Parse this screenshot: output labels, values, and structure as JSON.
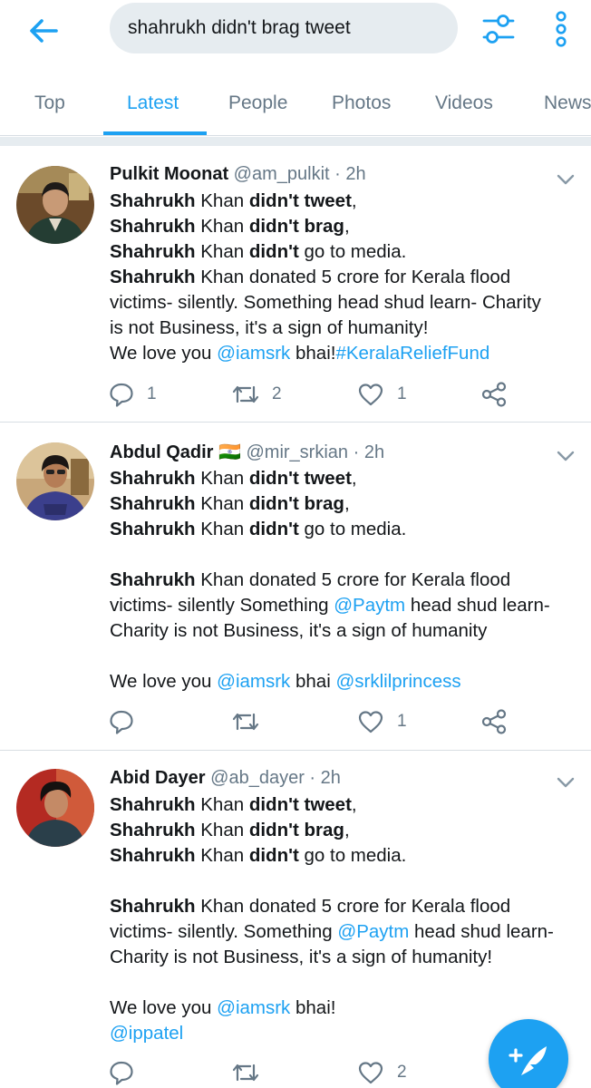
{
  "header": {
    "back_icon": "arrow-left-icon",
    "search_value": "shahrukh didn't brag tweet",
    "filter_icon": "sliders-icon",
    "more_icon": "vertical-dots-icon",
    "accent_color": "#1da1f2"
  },
  "tabs": [
    {
      "label": "Top"
    },
    {
      "label": "Latest",
      "active": true
    },
    {
      "label": "People"
    },
    {
      "label": "Photos"
    },
    {
      "label": "Videos"
    },
    {
      "label": "News"
    }
  ],
  "tweets": [
    {
      "name": "Pulkit Moonat",
      "handle": "@am_pulkit",
      "sep": "·",
      "time": "2h",
      "lines": [
        [
          "Shahrukh",
          "Khan",
          "didn't tweet",
          ","
        ],
        [
          "Shahrukh",
          "Khan",
          "didn't brag",
          ","
        ],
        [
          "Shahrukh",
          "Khan",
          "didn't",
          "go to media."
        ],
        [
          "Shahrukh",
          "Khan donated 5 crore for Kerala flood"
        ],
        [
          "victims- silently. Something  head shud learn- Charity"
        ],
        [
          "is not Business, it's a sign of humanity!"
        ],
        [
          "We love you ",
          "@iamsrk",
          " bhai!",
          "#KeralaReliefFund"
        ]
      ],
      "replies": "1",
      "retweets": "2",
      "likes": "1"
    },
    {
      "name": "Abdul Qadir",
      "flag": "🇮🇳",
      "handle": "@mir_srkian",
      "sep": "·",
      "time": "2h",
      "lines": [
        [
          "Shahrukh",
          "Khan",
          "didn't tweet",
          ","
        ],
        [
          "Shahrukh",
          "Khan",
          "didn't brag",
          ","
        ],
        [
          "Shahrukh",
          "Khan",
          "didn't",
          "go to media."
        ],
        [],
        [
          "Shahrukh",
          "Khan donated 5 crore for Kerala flood"
        ],
        [
          "victims- silently Something ",
          "@Paytm",
          " head shud learn-"
        ],
        [
          "Charity is not Business, it's a sign of humanity"
        ],
        [],
        [
          "We love you ",
          "@iamsrk",
          " bhai ",
          "@srklilprincess"
        ]
      ],
      "replies": "",
      "retweets": "",
      "likes": "1"
    },
    {
      "name": "Abid Dayer",
      "handle": "@ab_dayer",
      "sep": "·",
      "time": "2h",
      "lines": [
        [
          "Shahrukh",
          "Khan",
          "didn't tweet",
          ","
        ],
        [
          "Shahrukh",
          "Khan",
          "didn't brag",
          ","
        ],
        [
          "Shahrukh",
          "Khan",
          "didn't",
          "go to media."
        ],
        [],
        [
          "Shahrukh",
          "Khan donated 5 crore for Kerala flood"
        ],
        [
          "victims- silently. Something ",
          "@Paytm",
          " head shud learn-"
        ],
        [
          "Charity is not Business, it's a sign of humanity!"
        ],
        [],
        [
          "We love you ",
          "@iamsrk",
          " bhai!"
        ],
        [
          "@ippatel"
        ]
      ],
      "replies": "",
      "retweets": "",
      "likes": "2"
    }
  ],
  "icons": {
    "reply": "reply-bubble-icon",
    "retweet": "retweet-icon",
    "like": "heart-icon",
    "share": "share-icon",
    "caret": "chevron-down-icon",
    "compose": "compose-feather-icon"
  }
}
